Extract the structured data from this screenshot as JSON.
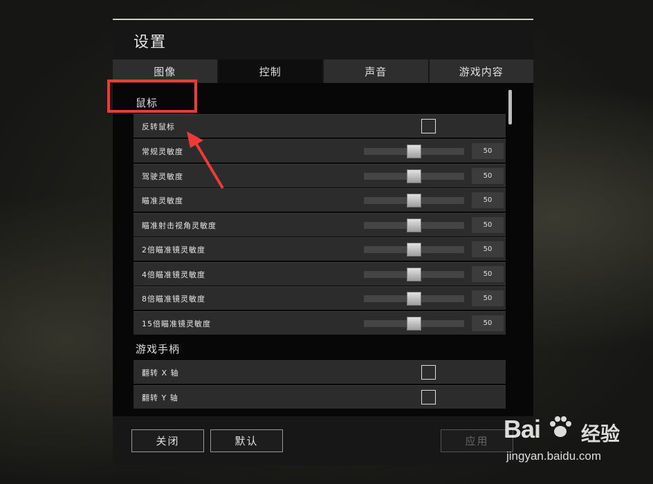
{
  "window": {
    "title": "设置"
  },
  "tabs": [
    {
      "label": "图像",
      "active": false
    },
    {
      "label": "控制",
      "active": true
    },
    {
      "label": "声音",
      "active": false
    },
    {
      "label": "游戏内容",
      "active": false
    }
  ],
  "sections": {
    "mouse": {
      "title": "鼠标",
      "invert_label": "反转鼠标",
      "invert_checked": false,
      "sliders": [
        {
          "label": "常规灵敏度",
          "value": "50",
          "level": 0.5
        },
        {
          "label": "驾驶灵敏度",
          "value": "50",
          "level": 0.5
        },
        {
          "label": "瞄准灵敏度",
          "value": "50",
          "level": 0.5
        },
        {
          "label": "瞄准射击视角灵敏度",
          "value": "50",
          "level": 0.5
        },
        {
          "label": "2倍瞄准镜灵敏度",
          "value": "50",
          "level": 0.5
        },
        {
          "label": "4倍瞄准镜灵敏度",
          "value": "50",
          "level": 0.5
        },
        {
          "label": "8倍瞄准镜灵敏度",
          "value": "50",
          "level": 0.5
        },
        {
          "label": "15倍瞄准镜灵敏度",
          "value": "50",
          "level": 0.5
        }
      ]
    },
    "gamepad": {
      "title": "游戏手柄",
      "invert_x_label": "翻转 X 轴",
      "invert_x_checked": false,
      "invert_y_label": "翻转 Y 轴",
      "invert_y_checked": false
    }
  },
  "footer": {
    "close_label": "关闭",
    "default_label": "默认",
    "apply_label": "应用",
    "apply_enabled": false
  },
  "watermark": {
    "logo_left": "Bai",
    "logo_right": "经验",
    "url": "jingyan.baidu.com"
  },
  "colors": {
    "annotation": "#ef3a3a",
    "panel": "#2c2c2c",
    "active_tab": "#0e0e0e"
  }
}
